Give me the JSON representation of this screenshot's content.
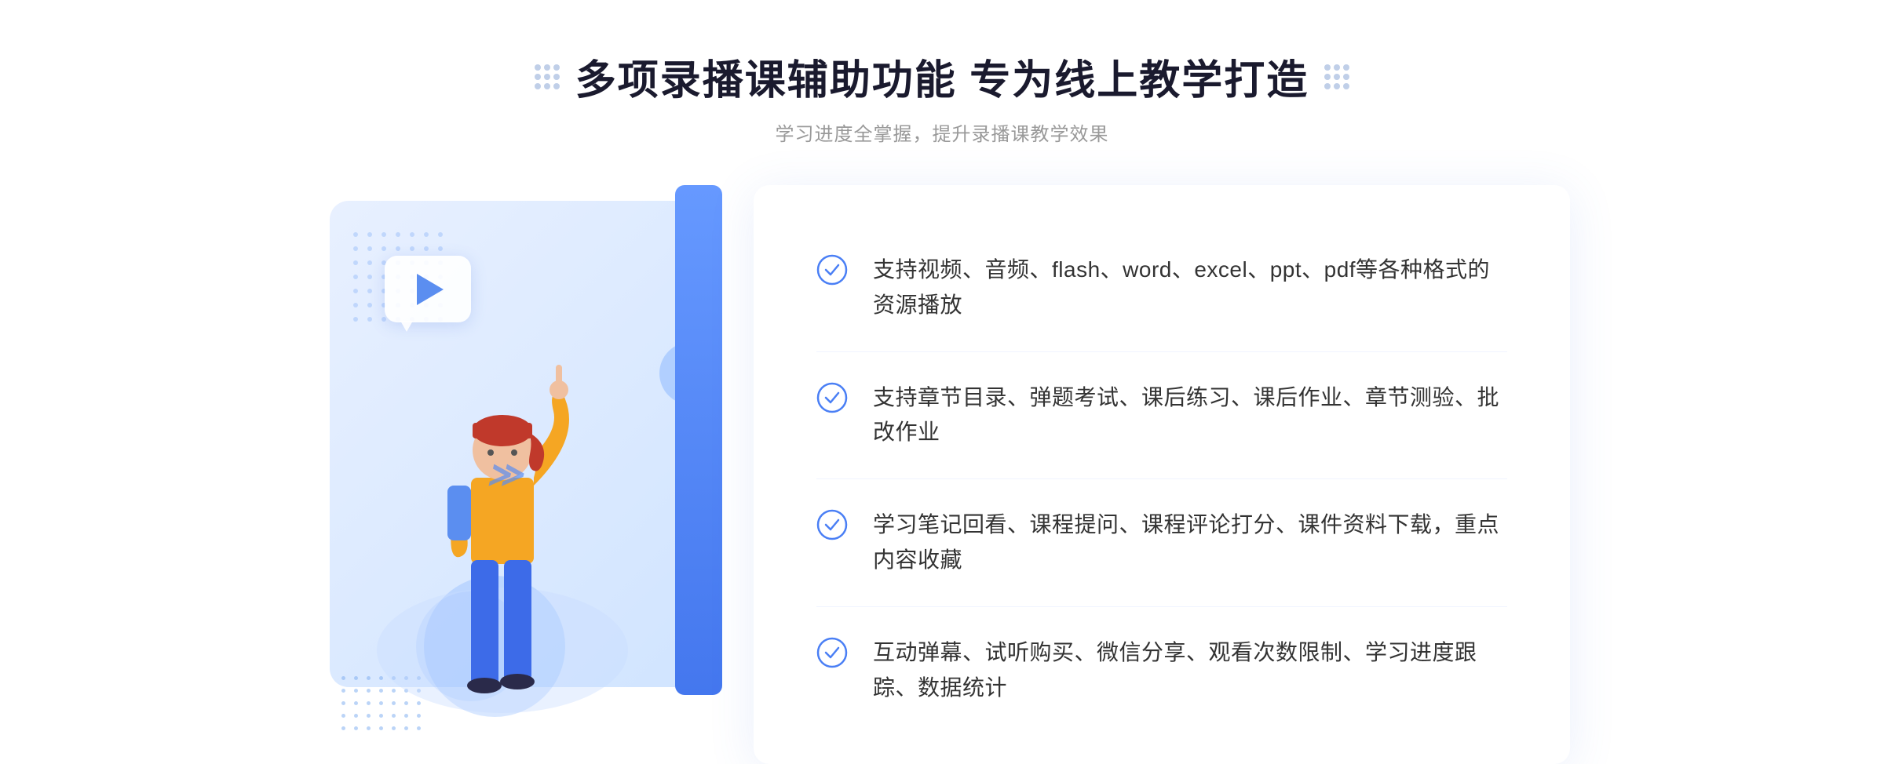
{
  "header": {
    "title": "多项录播课辅助功能 专为线上教学打造",
    "subtitle": "学习进度全掌握，提升录播课教学效果"
  },
  "features": [
    {
      "id": 1,
      "text": "支持视频、音频、flash、word、excel、ppt、pdf等各种格式的资源播放"
    },
    {
      "id": 2,
      "text": "支持章节目录、弹题考试、课后练习、课后作业、章节测验、批改作业"
    },
    {
      "id": 3,
      "text": "学习笔记回看、课程提问、课程评论打分、课件资料下载，重点内容收藏"
    },
    {
      "id": 4,
      "text": "互动弹幕、试听购买、微信分享、观看次数限制、学习进度跟踪、数据统计"
    }
  ],
  "icons": {
    "check": "check-circle-icon",
    "play": "play-icon",
    "chevron": "chevron-icon"
  },
  "colors": {
    "primary": "#4a7ff5",
    "primaryLight": "#6699ff",
    "titleColor": "#1a1a2e",
    "textColor": "#333333",
    "subtitleColor": "#999999",
    "bgLight": "#e8f0ff",
    "checkColor": "#4a7ff5"
  }
}
